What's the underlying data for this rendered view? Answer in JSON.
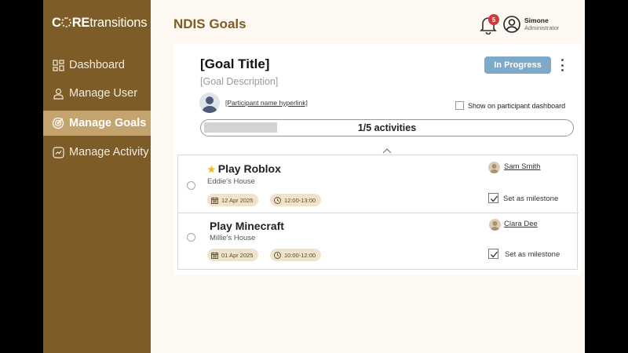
{
  "brand": {
    "logo_prefix": "C",
    "logo_bold_rest": "RE",
    "logo_rest": "transitions"
  },
  "sidebar": {
    "items": [
      {
        "label": "Dashboard",
        "icon": "dashboard-icon",
        "active": false
      },
      {
        "label": "Manage User",
        "icon": "user-icon",
        "active": false
      },
      {
        "label": "Manage Goals",
        "icon": "target-icon",
        "active": true
      },
      {
        "label": "Manage Activity",
        "icon": "activity-icon",
        "active": false
      }
    ]
  },
  "header": {
    "title": "NDIS Goals",
    "notification_count": "5",
    "user": {
      "name": "Simone",
      "role": "Administrator"
    }
  },
  "goal": {
    "title": "[Goal Title]",
    "description": "[Goal Description]",
    "status": "In Progress",
    "participant_link": "[Participant name hyperlink]",
    "show_on_dashboard_label": "Show on participant dashboard",
    "show_on_dashboard": false,
    "progress_label": "1/5 activities",
    "progress_fraction": 0.2
  },
  "activities": [
    {
      "title": "Play Roblox",
      "starred": true,
      "location": "Eddie's House",
      "date": "12 Apr 2025",
      "time": "12:00-13:00",
      "assignee": "Sam Smith",
      "milestone_label": "Set as milestone",
      "milestone": true
    },
    {
      "title": "Play Minecraft",
      "starred": false,
      "location": "Millie's House",
      "date": "01 Apr 2025",
      "time": "10:00-12:00",
      "assignee": "Clara Dee",
      "milestone_label": "Set as milestone",
      "milestone": true
    }
  ],
  "colors": {
    "sidebar": "#7d5c27",
    "sidebar_active": "#c4a46e",
    "page_background": "#fdf8f1",
    "status_pill": "#7fa9c9",
    "chip": "#efe3c9",
    "star": "#f2b824",
    "badge": "#d03a3a"
  }
}
